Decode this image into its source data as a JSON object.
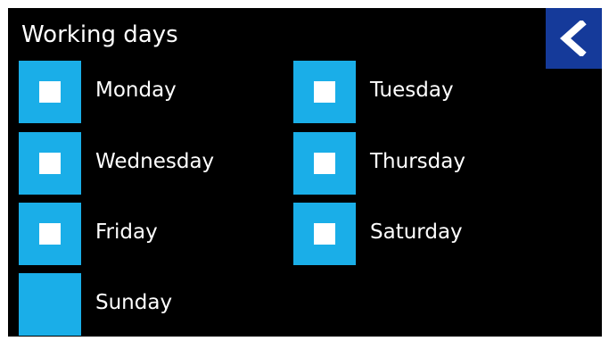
{
  "header": {
    "title": "Working days",
    "back_icon": "chevron-left-icon"
  },
  "colors": {
    "background": "#000000",
    "checkbox": "#1aaee8",
    "check_mark": "#ffffff",
    "back_button": "#153a9a"
  },
  "days": [
    {
      "label": "Monday",
      "checked": true
    },
    {
      "label": "Tuesday",
      "checked": true
    },
    {
      "label": "Wednesday",
      "checked": true
    },
    {
      "label": "Thursday",
      "checked": true
    },
    {
      "label": "Friday",
      "checked": true
    },
    {
      "label": "Saturday",
      "checked": true
    },
    {
      "label": "Sunday",
      "checked": false
    }
  ]
}
